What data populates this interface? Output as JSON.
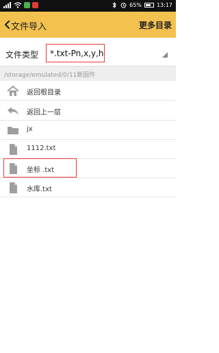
{
  "status_bar": {
    "battery_percent": "65%",
    "time": "13:17"
  },
  "app_bar": {
    "title": "文件导入",
    "more_button": "更多目录"
  },
  "file_type": {
    "label": "文件类型",
    "value": "*.txt-Pn,x,y,h"
  },
  "path": "/storage/emulated/0/11新固件",
  "items": [
    {
      "label": "返回根目录",
      "icon": "home-icon"
    },
    {
      "label": "返回上一层",
      "icon": "undo-arrow-icon"
    },
    {
      "label": "jx",
      "icon": "folder-icon"
    },
    {
      "label": "1112.txt",
      "icon": "file-icon"
    },
    {
      "label": "坐标 .txt",
      "icon": "file-icon"
    },
    {
      "label": "水库.txt",
      "icon": "file-icon"
    }
  ],
  "colors": {
    "accent": "#f2c14e",
    "highlight_border": "#e53935",
    "icon_gray": "#9e9e9e"
  }
}
